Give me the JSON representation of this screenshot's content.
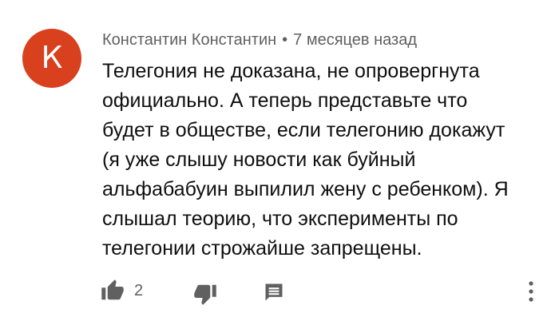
{
  "comment": {
    "avatar_letter": "К",
    "avatar_color": "#d8401e",
    "author": "Константин Константин",
    "separator": "•",
    "timestamp": "7 месяцев назад",
    "text": "Телегония не доказана, не опровергнута официально. А теперь представьте что будет в обществе, если телегонию докажут (я уже слышу новости как буйный альфабабуин выпилил жену с ребенком). Я слышал теорию, что эксперименты по телегонии строжайше запрещены.",
    "like_count": "2"
  },
  "icons": {
    "like": "thumbs-up-icon",
    "dislike": "thumbs-down-icon",
    "reply": "comment-reply-icon",
    "more": "more-vertical-icon"
  },
  "colors": {
    "text_primary": "#0f0f0f",
    "text_secondary": "#606060",
    "icon": "#606060"
  }
}
